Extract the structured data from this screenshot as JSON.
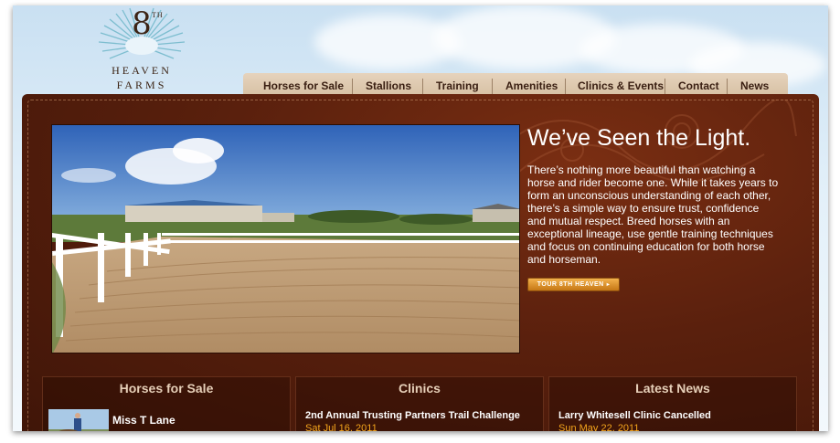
{
  "logo": {
    "numeral": "8",
    "superscript": "TH",
    "line1": "HEAVEN",
    "line2": "FARMS"
  },
  "nav": {
    "items": [
      {
        "label": "Horses for Sale"
      },
      {
        "label": "Stallions"
      },
      {
        "label": "Training"
      },
      {
        "label": "Amenities"
      },
      {
        "label": "Clinics & Events"
      },
      {
        "label": "Contact"
      },
      {
        "label": "News"
      }
    ]
  },
  "hero": {
    "headline": "We’ve Seen the Light.",
    "body": "There’s nothing more beautiful than watching a horse and rider become one. While it takes years to form an unconscious understanding of each other, there’s a simple way to ensure trust, confidence and mutual respect. Breed horses with an exceptional lineage, use gentle training techniques and focus on continuing education for both horse and horseman.",
    "button_label": "TOUR 8TH HEAVEN",
    "button_arrow": "▸"
  },
  "columns": {
    "horses": {
      "title": "Horses for Sale",
      "item_name": "Miss T Lane"
    },
    "clinics": {
      "title": "Clinics",
      "item_title": "2nd Annual Trusting Partners Trail Challenge",
      "item_date": "Sat Jul 16, 2011"
    },
    "news": {
      "title": "Latest News",
      "item_title": "Larry Whitesell Clinic Cancelled",
      "item_date": "Sun May 22, 2011"
    }
  },
  "colors": {
    "brand_brown": "#5a200d",
    "nav_tan": "#d4bd9f",
    "accent_orange": "#f4a51c",
    "sky": "#c9e0f2"
  }
}
